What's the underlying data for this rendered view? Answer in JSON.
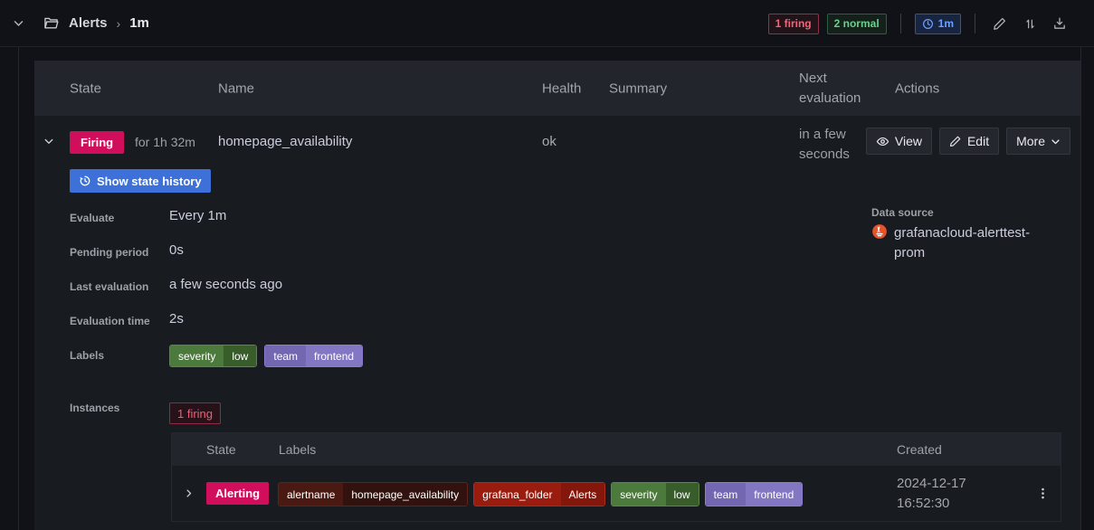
{
  "breadcrumb": {
    "folder_label": "Alerts",
    "separator": "›",
    "current": "1m"
  },
  "topbar": {
    "firing_badge": "1 firing",
    "normal_badge": "2 normal",
    "interval_badge": "1m"
  },
  "rule_table": {
    "headers": {
      "state": "State",
      "name": "Name",
      "health": "Health",
      "summary": "Summary",
      "next_evaluation": "Next evaluation",
      "actions": "Actions"
    },
    "row": {
      "state_badge": "Firing",
      "firing_for": "for 1h 32m",
      "name": "homepage_availability",
      "health": "ok",
      "next_evaluation": "in a few seconds",
      "view_button": "View",
      "edit_button": "Edit",
      "more_button": "More"
    }
  },
  "details": {
    "show_state_history_button": "Show state history",
    "evaluate": {
      "label": "Evaluate",
      "value": "Every 1m"
    },
    "pending_period": {
      "label": "Pending period",
      "value": "0s"
    },
    "last_evaluation": {
      "label": "Last evaluation",
      "value": "a few seconds ago"
    },
    "evaluation_time": {
      "label": "Evaluation time",
      "value": "2s"
    },
    "labels": {
      "label": "Labels",
      "chips": [
        {
          "key": "severity",
          "value": "low",
          "color": "green"
        },
        {
          "key": "team",
          "value": "frontend",
          "color": "purple"
        }
      ]
    },
    "data_source": {
      "label": "Data source",
      "name": "grafanacloud-alerttest-prom"
    },
    "instances": {
      "label": "Instances",
      "firing_count_badge": "1 firing"
    }
  },
  "instances_table": {
    "headers": {
      "state": "State",
      "labels": "Labels",
      "created": "Created"
    },
    "row": {
      "state_badge": "Alerting",
      "labels": [
        {
          "key": "alertname",
          "value": "homepage_availability",
          "color": "darkred"
        },
        {
          "key": "grafana_folder",
          "value": "Alerts",
          "color": "red"
        },
        {
          "key": "severity",
          "value": "low",
          "color": "green"
        },
        {
          "key": "team",
          "value": "frontend",
          "color": "purple"
        }
      ],
      "created": "2024-12-17 16:52:30"
    }
  },
  "colors": {
    "page_bg": "#111217",
    "panel_bg": "#181b1f",
    "header_bg": "#22252b",
    "text_primary": "#ccccdc",
    "text_secondary": "#9da0a8",
    "firing_badge_bg": "#d10e5c",
    "primary_button_bg": "#3d71d9",
    "firing_pill_text": "#f0657b",
    "normal_pill_text": "#6ccf8e",
    "interval_pill_text": "#6e9fff",
    "prometheus_orange": "#e6522c",
    "chip_green_key": "#4c7a3c",
    "chip_green_value": "#395c2b",
    "chip_purple_key": "#7467b2",
    "chip_purple_value": "#8376c3",
    "chip_darkred_key": "#4a1a12",
    "chip_darkred_value": "#31120e",
    "chip_red_key": "#9a1c0f",
    "chip_red_value": "#84170c"
  }
}
